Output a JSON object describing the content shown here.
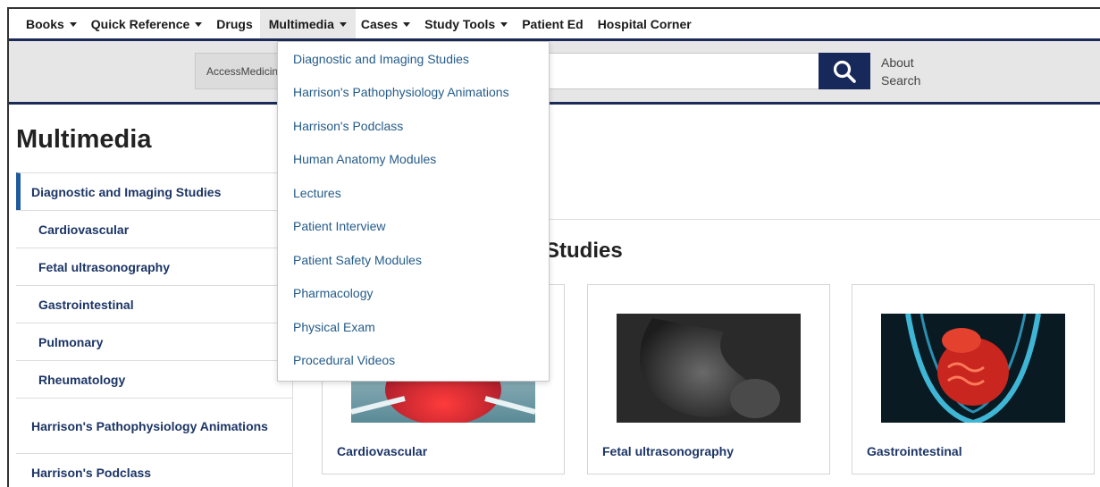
{
  "topnav": {
    "items": [
      {
        "label": "Books",
        "caret": true
      },
      {
        "label": "Quick Reference",
        "caret": true
      },
      {
        "label": "Drugs",
        "caret": false
      },
      {
        "label": "Multimedia",
        "caret": true
      },
      {
        "label": "Cases",
        "caret": true
      },
      {
        "label": "Study Tools",
        "caret": true
      },
      {
        "label": "Patient Ed",
        "caret": false
      },
      {
        "label": "Hospital Corner",
        "caret": false
      }
    ]
  },
  "search": {
    "scope_label": "AccessMedicine",
    "placeholder": "",
    "about_label": "About Search"
  },
  "sidebar": {
    "title": "Multimedia",
    "items": [
      {
        "label": "Diagnostic and Imaging Studies"
      },
      {
        "label": "Cardiovascular"
      },
      {
        "label": "Fetal ultrasonography"
      },
      {
        "label": "Gastrointestinal"
      },
      {
        "label": "Pulmonary"
      },
      {
        "label": "Rheumatology"
      },
      {
        "label": "Harrison's Pathophysiology Animations"
      },
      {
        "label": "Harrison's Podclass"
      }
    ]
  },
  "main": {
    "section_title": "Studies",
    "cards": [
      {
        "caption": "Cardiovascular"
      },
      {
        "caption": "Fetal ultrasonography"
      },
      {
        "caption": "Gastrointestinal"
      }
    ]
  },
  "dropdown": {
    "items": [
      "Diagnostic and Imaging Studies",
      "Harrison's Pathophysiology Animations",
      "Harrison's Podclass",
      "Human Anatomy Modules",
      "Lectures",
      "Patient Interview",
      "Patient Safety Modules",
      "Pharmacology",
      "Physical Exam",
      "Procedural Videos"
    ]
  },
  "colors": {
    "brand_navy": "#17285a",
    "link_blue": "#255c8a",
    "selected_bar": "#1f5b9c"
  }
}
